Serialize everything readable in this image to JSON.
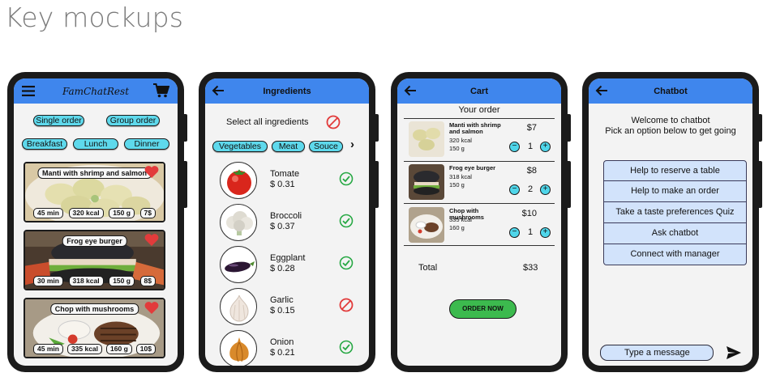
{
  "page": {
    "title": "Key mockups"
  },
  "menu_screen": {
    "brand": "FamChatRest",
    "order_types": [
      "Single order",
      "Group order"
    ],
    "meals": [
      "Breakfast",
      "Lunch",
      "Dinner"
    ],
    "dishes": [
      {
        "name": "Manti with shrimp and salmon",
        "time": "45 min",
        "kcal": "320 kcal",
        "weight": "150 g",
        "price": "7$"
      },
      {
        "name": "Frog eye burger",
        "time": "30 min",
        "kcal": "318 kcal",
        "weight": "150 g",
        "price": "8$"
      },
      {
        "name": "Chop with mushrooms",
        "time": "45 min",
        "kcal": "335 kcal",
        "weight": "160 g",
        "price": "10$"
      }
    ]
  },
  "ingredients_screen": {
    "title": "Ingredients",
    "select_all": "Select all ingredients",
    "categories": [
      "Vegetables",
      "Meat",
      "Souce"
    ],
    "more": "›",
    "items": [
      {
        "name": "Tomate",
        "price": "$ 0.31",
        "status": "check"
      },
      {
        "name": "Broccoli",
        "price": "$ 0.37",
        "status": "check"
      },
      {
        "name": "Eggplant",
        "price": "$ 0.28",
        "status": "check"
      },
      {
        "name": "Garlic",
        "price": "$ 0.15",
        "status": "forbidden"
      },
      {
        "name": "Onion",
        "price": "$ 0.21",
        "status": "check"
      }
    ]
  },
  "cart_screen": {
    "title": "Cart",
    "heading": "Your order",
    "items": [
      {
        "name": "Manti with shrimp and salmon",
        "kcal": "320 kcal",
        "weight": "150 g",
        "price": "$7",
        "qty": "1"
      },
      {
        "name": "Frog eye burger",
        "kcal": "318 kcal",
        "weight": "150 g",
        "price": "$8",
        "qty": "2"
      },
      {
        "name": "Chop with mushrooms",
        "kcal": "335 kcal",
        "weight": "160 g",
        "price": "$10",
        "qty": "1"
      }
    ],
    "total_label": "Total",
    "total_value": "$33",
    "order_button": "ORDER NOW"
  },
  "chat_screen": {
    "title": "Chatbot",
    "welcome_1": "Welcome to chatbot",
    "welcome_2": "Pick an option below to get going",
    "options": [
      "Help to reserve a table",
      "Help to make an order",
      "Take a taste preferences Quiz",
      "Ask chatbot",
      "Connect with manager"
    ],
    "input_placeholder": "Type a message"
  },
  "colors": {
    "appbar": "#3f86ed",
    "pill": "#5ed9ec",
    "check": "#27a844",
    "forbidden": "#e23b3b",
    "order_button": "#3cba4e",
    "chat_option": "#d2e3fb"
  }
}
